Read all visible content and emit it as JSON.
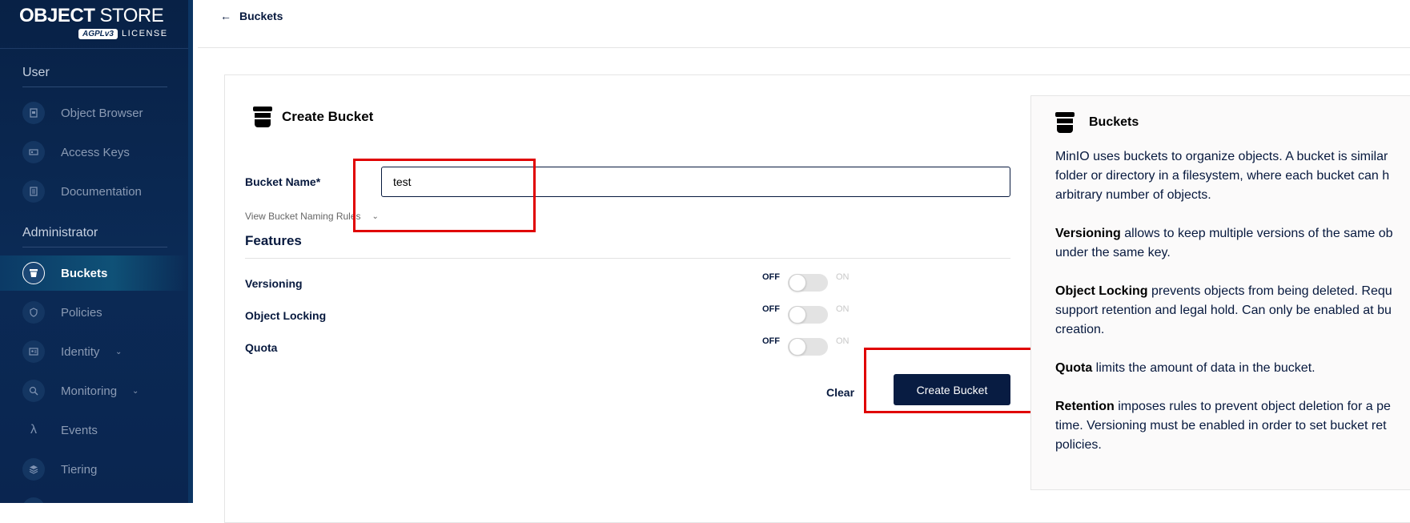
{
  "brand": {
    "title_bold": "OBJECT",
    "title_light": "STORE",
    "badge": "AGPLv3",
    "license": "LICENSE"
  },
  "sidebar": {
    "user_section": "User",
    "admin_section": "Administrator",
    "user_items": [
      {
        "label": "Object Browser",
        "icon": "object-browser-icon"
      },
      {
        "label": "Access Keys",
        "icon": "access-keys-icon"
      },
      {
        "label": "Documentation",
        "icon": "documentation-icon"
      }
    ],
    "admin_items": [
      {
        "label": "Buckets",
        "icon": "bucket-icon",
        "active": true
      },
      {
        "label": "Policies",
        "icon": "policies-icon"
      },
      {
        "label": "Identity",
        "icon": "identity-icon",
        "expandable": true
      },
      {
        "label": "Monitoring",
        "icon": "monitoring-icon",
        "expandable": true
      },
      {
        "label": "Events",
        "icon": "lambda-icon"
      },
      {
        "label": "Tiering",
        "icon": "tiering-icon"
      }
    ]
  },
  "topbar": {
    "back_label": "Buckets"
  },
  "form": {
    "title": "Create Bucket",
    "name_label": "Bucket Name*",
    "name_value": "test",
    "naming_rules": "View Bucket Naming Rules",
    "features_title": "Features",
    "toggles": [
      {
        "label": "Versioning",
        "off": "OFF",
        "on": "ON",
        "enabled": false
      },
      {
        "label": "Object Locking",
        "off": "OFF",
        "on": "ON",
        "enabled": false
      },
      {
        "label": "Quota",
        "off": "OFF",
        "on": "ON",
        "enabled": false
      }
    ],
    "clear_label": "Clear",
    "create_label": "Create Bucket"
  },
  "help": {
    "title": "Buckets",
    "p1_line1": "MinIO uses buckets to organize objects. A bucket is similar",
    "p1_line2": "folder or directory in a filesystem, where each bucket can h",
    "p1_line3": "arbitrary number of objects.",
    "versioning_term": "Versioning",
    "versioning_line1": " allows to keep multiple versions of the same ob",
    "versioning_line2": "under the same key.",
    "locking_term": "Object Locking",
    "locking_line1": " prevents objects from being deleted. Requ",
    "locking_line2": "support retention and legal hold. Can only be enabled at bu",
    "locking_line3": "creation.",
    "quota_term": "Quota",
    "quota_line1": " limits the amount of data in the bucket.",
    "retention_term": "Retention",
    "retention_line1": " imposes rules to prevent object deletion for a pe",
    "retention_line2": "time. Versioning must be enabled in order to set bucket ret",
    "retention_line3": "policies."
  },
  "colors": {
    "sidebar_bg": "#0b2a55",
    "primary_button": "#081c42",
    "highlight": "#e00000"
  }
}
